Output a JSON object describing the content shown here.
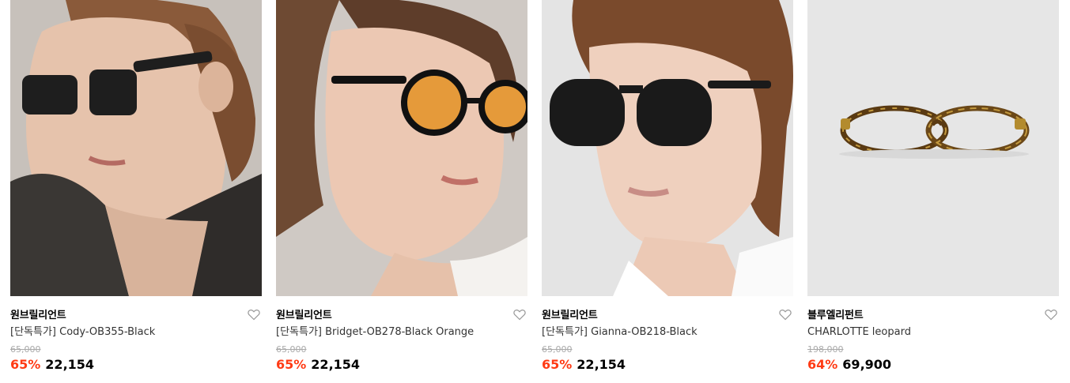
{
  "colors": {
    "discount": "#ff3b15",
    "heart": "#999999",
    "original_price": "#aaaaaa"
  },
  "products": [
    {
      "brand": "원브릴리언트",
      "name": "[단독특가] Cody-OB355-Black",
      "original_price": "65,000",
      "discount": "65%",
      "price": "22,154",
      "wishlist_icon": "heart-outline-icon",
      "image_alt": "woman wearing black square sunglasses"
    },
    {
      "brand": "원브릴리언트",
      "name": "[단독특가] Bridget-OB278-Black Orange",
      "original_price": "65,000",
      "discount": "65%",
      "price": "22,154",
      "wishlist_icon": "heart-outline-icon",
      "image_alt": "woman wearing round black sunglasses with orange lenses"
    },
    {
      "brand": "원브릴리언트",
      "name": "[단독특가] Gianna-OB218-Black",
      "original_price": "65,000",
      "discount": "65%",
      "price": "22,154",
      "wishlist_icon": "heart-outline-icon",
      "image_alt": "woman wearing black round sunglasses"
    },
    {
      "brand": "블루엘리펀트",
      "name": "CHARLOTTE leopard",
      "original_price": "198,000",
      "discount": "64%",
      "price": "69,900",
      "wishlist_icon": "heart-outline-icon",
      "image_alt": "oval tortoiseshell eyeglasses"
    }
  ]
}
